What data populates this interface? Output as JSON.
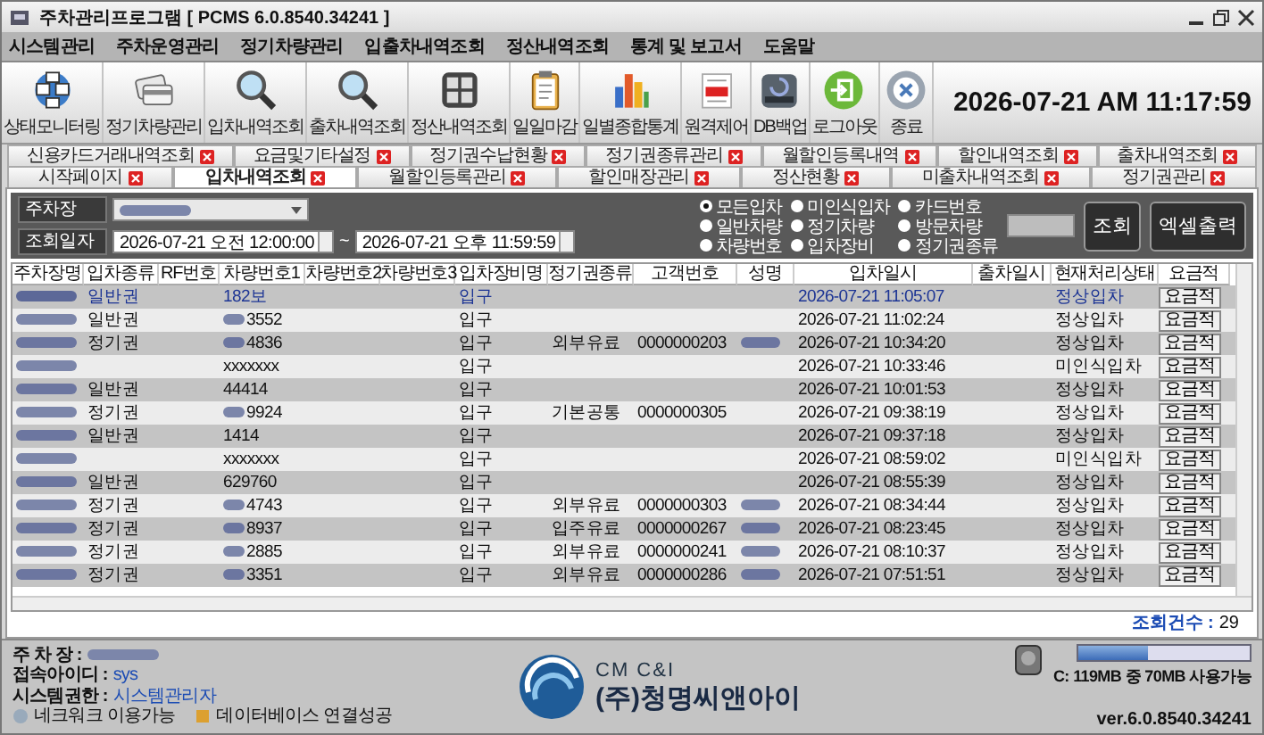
{
  "window": {
    "title": "주차관리프로그램 [ PCMS 6.0.8540.34241 ]"
  },
  "menu": [
    "시스템관리",
    "주차운영관리",
    "정기차량관리",
    "입출차내역조회",
    "정산내역조회",
    "통계 및 보고서",
    "도움말"
  ],
  "toolbar": [
    {
      "label": "상태모니터링",
      "kind": "monitor"
    },
    {
      "label": "정기차량관리",
      "kind": "cards"
    },
    {
      "label": "입차내역조회",
      "kind": "search"
    },
    {
      "label": "출차내역조회",
      "kind": "search"
    },
    {
      "label": "정산내역조회",
      "kind": "calculator"
    },
    {
      "label": "일일마감",
      "kind": "clipboard"
    },
    {
      "label": "일별종합통계",
      "kind": "chart"
    },
    {
      "label": "원격제어",
      "kind": "sale"
    },
    {
      "label": "DB백업",
      "kind": "disk"
    },
    {
      "label": "로그아웃",
      "kind": "logout"
    },
    {
      "label": "종료",
      "kind": "close"
    }
  ],
  "clock": "2026-07-21 AM 11:17:59",
  "tabs_row1": [
    {
      "label": "신용카드거래내역조회",
      "selected": false
    },
    {
      "label": "요금및기타설정",
      "selected": false
    },
    {
      "label": "정기권수납현황",
      "selected": false
    },
    {
      "label": "정기권종류관리",
      "selected": false
    },
    {
      "label": "월할인등록내역",
      "selected": false
    },
    {
      "label": "할인내역조회",
      "selected": false
    },
    {
      "label": "출차내역조회",
      "selected": false
    }
  ],
  "tabs_row2": [
    {
      "label": "시작페이지",
      "selected": false
    },
    {
      "label": "입차내역조회",
      "selected": true
    },
    {
      "label": "월할인등록관리",
      "selected": false
    },
    {
      "label": "할인매장관리",
      "selected": false
    },
    {
      "label": "정산현황",
      "selected": false
    },
    {
      "label": "미출차내역조회",
      "selected": false
    },
    {
      "label": "정기권관리",
      "selected": false
    }
  ],
  "filter": {
    "lot_label": "주차장",
    "lot_redacted": true,
    "date_label": "조회일자",
    "date_from": "2026-07-21 오전 12:00:00",
    "separator": "~",
    "date_to": "2026-07-21 오후 11:59:59",
    "options": [
      {
        "label": "모든입차",
        "selected": true
      },
      {
        "label": "일반차량",
        "selected": false
      },
      {
        "label": "차량번호",
        "selected": false
      },
      {
        "label": "미인식입차",
        "selected": false
      },
      {
        "label": "정기차량",
        "selected": false
      },
      {
        "label": "입차장비",
        "selected": false
      },
      {
        "label": "카드번호",
        "selected": false
      },
      {
        "label": "방문차량",
        "selected": false
      },
      {
        "label": "정기권종류",
        "selected": false
      }
    ],
    "buttons": [
      "조회",
      "엑셀출력"
    ]
  },
  "table": {
    "columns": [
      "주차장명",
      "입차종류",
      "RF번호",
      "차량번호1",
      "차량번호2",
      "차량번호3",
      "입차장비명",
      "정기권종류",
      "고객번호",
      "성명",
      "입차일시",
      "출차일시",
      "현재처리상태",
      "요금적"
    ],
    "rows": [
      {
        "selected": true,
        "lot_redacted": true,
        "entry_type": "일반권",
        "plate": "182보",
        "plate_redacted": false,
        "device": "입구",
        "name_redacted": false,
        "entry_time": "2026-07-21 11:05:07",
        "status": "정상입차",
        "fee_button": "요금적"
      },
      {
        "selected": false,
        "lot_redacted": true,
        "entry_type": "일반권",
        "plate": "3552",
        "plate_redacted": true,
        "device": "입구",
        "name_redacted": false,
        "entry_time": "2026-07-21 11:02:24",
        "status": "정상입차",
        "fee_button": "요금적"
      },
      {
        "selected": false,
        "lot_redacted": true,
        "entry_type": "정기권",
        "plate": "4836",
        "plate_redacted": true,
        "device": "입구",
        "pass_type": "외부유료",
        "customer_no": "0000000203",
        "name_redacted": true,
        "entry_time": "2026-07-21 10:34:20",
        "status": "정상입차",
        "fee_button": "요금적"
      },
      {
        "selected": false,
        "lot_redacted": true,
        "plate": "xxxxxxx",
        "plate_redacted": false,
        "device": "입구",
        "name_redacted": false,
        "entry_time": "2026-07-21 10:33:46",
        "status": "미인식입차",
        "fee_button": "요금적"
      },
      {
        "selected": false,
        "lot_redacted": true,
        "entry_type": "일반권",
        "plate": "44414",
        "plate_redacted": false,
        "device": "입구",
        "name_redacted": false,
        "entry_time": "2026-07-21 10:01:53",
        "status": "정상입차",
        "fee_button": "요금적"
      },
      {
        "selected": false,
        "lot_redacted": true,
        "entry_type": "정기권",
        "plate": "9924",
        "plate_redacted": true,
        "device": "입구",
        "pass_type": "기본공통",
        "customer_no": "0000000305",
        "name_redacted": false,
        "entry_time": "2026-07-21 09:38:19",
        "status": "정상입차",
        "fee_button": "요금적"
      },
      {
        "selected": false,
        "lot_redacted": true,
        "entry_type": "일반권",
        "plate": "1414",
        "plate_redacted": false,
        "device": "입구",
        "name_redacted": false,
        "entry_time": "2026-07-21 09:37:18",
        "status": "정상입차",
        "fee_button": "요금적"
      },
      {
        "selected": false,
        "lot_redacted": true,
        "plate": "xxxxxxx",
        "plate_redacted": false,
        "device": "입구",
        "name_redacted": false,
        "entry_time": "2026-07-21 08:59:02",
        "status": "미인식입차",
        "fee_button": "요금적"
      },
      {
        "selected": false,
        "lot_redacted": true,
        "entry_type": "일반권",
        "plate": "629760",
        "plate_redacted": false,
        "device": "입구",
        "name_redacted": false,
        "entry_time": "2026-07-21 08:55:39",
        "status": "정상입차",
        "fee_button": "요금적"
      },
      {
        "selected": false,
        "lot_redacted": true,
        "entry_type": "정기권",
        "plate": "4743",
        "plate_redacted": true,
        "device": "입구",
        "pass_type": "외부유료",
        "customer_no": "0000000303",
        "name_redacted": true,
        "entry_time": "2026-07-21 08:34:44",
        "status": "정상입차",
        "fee_button": "요금적"
      },
      {
        "selected": false,
        "lot_redacted": true,
        "entry_type": "정기권",
        "plate": "8937",
        "plate_redacted": true,
        "device": "입구",
        "pass_type": "입주유료",
        "customer_no": "0000000267",
        "name_redacted": true,
        "entry_time": "2026-07-21 08:23:45",
        "status": "정상입차",
        "fee_button": "요금적"
      },
      {
        "selected": false,
        "lot_redacted": true,
        "entry_type": "정기권",
        "plate": "2885",
        "plate_redacted": true,
        "device": "입구",
        "pass_type": "외부유료",
        "customer_no": "0000000241",
        "name_redacted": true,
        "entry_time": "2026-07-21 08:10:37",
        "status": "정상입차",
        "fee_button": "요금적"
      },
      {
        "selected": false,
        "lot_redacted": true,
        "entry_type": "정기권",
        "plate": "3351",
        "plate_redacted": true,
        "device": "입구",
        "pass_type": "외부유료",
        "customer_no": "0000000286",
        "name_redacted": true,
        "entry_time": "2026-07-21 07:51:51",
        "status": "정상입차",
        "fee_button": "요금적"
      }
    ]
  },
  "result_count": {
    "label": "조회건수 :",
    "value": "29"
  },
  "footer": {
    "lot_label": "주 차 장 :",
    "lot_redacted": true,
    "user_label": "접속아이디 :",
    "user": "sys",
    "role_label": "시스템권한 :",
    "role": "시스템관리자",
    "network": "네크워크 이용가능",
    "database": "데이터베이스 연결성공",
    "logo_top": "CM C&I",
    "logo_bottom": "(주)청명씨앤아이",
    "disk": {
      "level": 0.41,
      "text": "C: 119MB 중 70MB 사용가능"
    },
    "version": "ver.6.0.8540.34241"
  }
}
